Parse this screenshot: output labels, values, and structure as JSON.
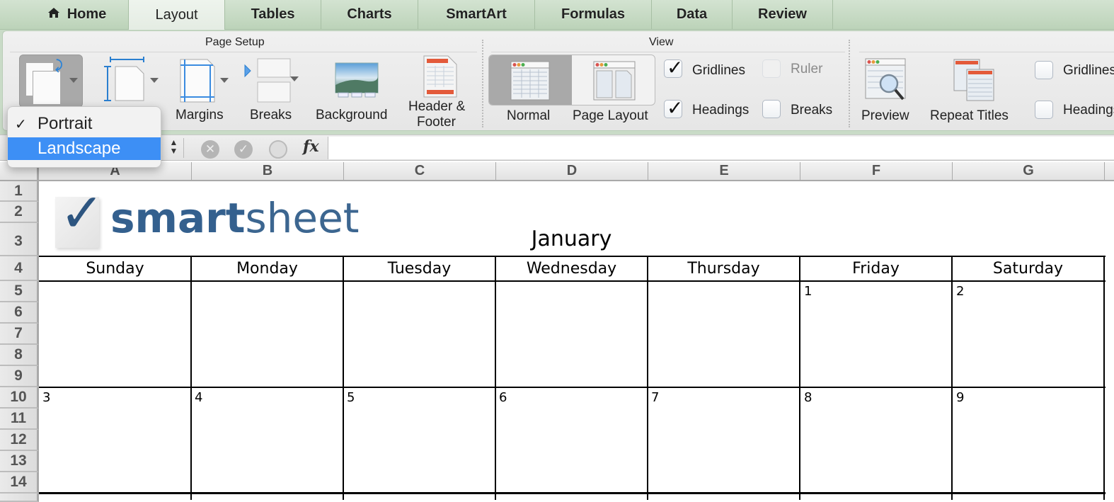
{
  "tabs": [
    {
      "label": "Home",
      "icon": "home-icon"
    },
    {
      "label": "Layout",
      "active": true
    },
    {
      "label": "Tables"
    },
    {
      "label": "Charts"
    },
    {
      "label": "SmartArt"
    },
    {
      "label": "Formulas"
    },
    {
      "label": "Data"
    },
    {
      "label": "Review"
    }
  ],
  "ribbon": {
    "page_setup": {
      "title": "Page Setup",
      "buttons": {
        "margins": "Margins",
        "breaks": "Breaks",
        "background": "Background",
        "header_footer_1": "Header &",
        "header_footer_2": "Footer"
      }
    },
    "view": {
      "title": "View",
      "normal": "Normal",
      "page_layout": "Page Layout",
      "gridlines": {
        "label": "Gridlines",
        "checked": true
      },
      "ruler": {
        "label": "Ruler",
        "checked": false,
        "disabled": true
      },
      "headings": {
        "label": "Headings",
        "checked": true
      },
      "breaks": {
        "label": "Breaks",
        "checked": false
      }
    },
    "print": {
      "preview": "Preview",
      "repeat_titles": "Repeat Titles",
      "gridlines": {
        "label": "Gridlines",
        "checked": false
      },
      "headings": {
        "label": "Headings",
        "checked": false
      }
    }
  },
  "orientation_menu": {
    "items": [
      {
        "label": "Portrait",
        "checked": true
      },
      {
        "label": "Landscape",
        "highlighted": true
      }
    ]
  },
  "formula_bar": {
    "fx": "fx",
    "value": ""
  },
  "sheet": {
    "columns": [
      "A",
      "B",
      "C",
      "D",
      "E",
      "F",
      "G"
    ],
    "rows": [
      "1",
      "2",
      "3",
      "4",
      "5",
      "6",
      "7",
      "8",
      "9",
      "10",
      "11",
      "12",
      "13",
      "14"
    ],
    "logo_text_a": "smart",
    "logo_text_b": "sheet",
    "month": "January",
    "days": [
      "Sunday",
      "Monday",
      "Tuesday",
      "Wednesday",
      "Thursday",
      "Friday",
      "Saturday"
    ],
    "week1": [
      "",
      "",
      "",
      "",
      "",
      "1",
      "2"
    ],
    "week2": [
      "3",
      "4",
      "5",
      "6",
      "7",
      "8",
      "9"
    ]
  }
}
